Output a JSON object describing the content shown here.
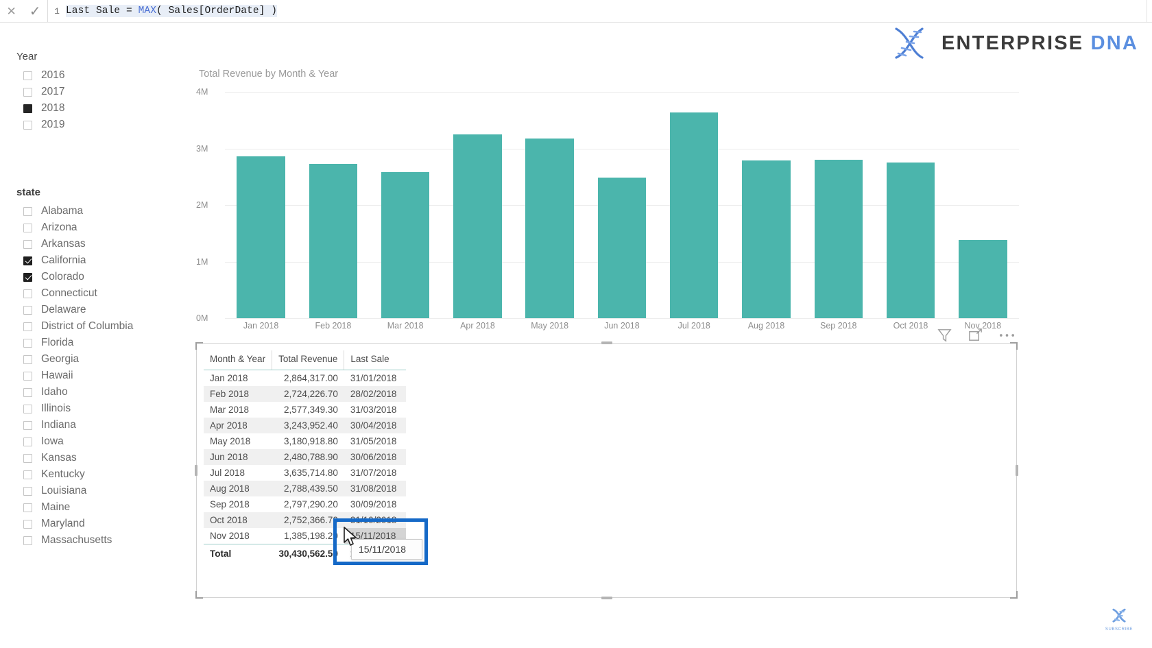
{
  "formula_bar": {
    "line_number": "1",
    "text_prefix": "Last Sale = ",
    "function": "MAX",
    "text_suffix": "( Sales[OrderDate] )",
    "full_text": "Last Sale = MAX( Sales[OrderDate] )",
    "cancel_icon": "close-icon",
    "commit_icon": "checkmark-icon"
  },
  "brand": {
    "logo_icon": "dna-helix-icon",
    "name_primary": "ENTERPRISE",
    "name_secondary": "DNA"
  },
  "slicers": {
    "year": {
      "title": "Year",
      "items": [
        {
          "label": "2016",
          "state": "unchecked"
        },
        {
          "label": "2017",
          "state": "unchecked"
        },
        {
          "label": "2018",
          "state": "filled"
        },
        {
          "label": "2019",
          "state": "unchecked"
        }
      ]
    },
    "state": {
      "title": "state",
      "items": [
        {
          "label": "Alabama",
          "state": "unchecked"
        },
        {
          "label": "Arizona",
          "state": "unchecked"
        },
        {
          "label": "Arkansas",
          "state": "unchecked"
        },
        {
          "label": "California",
          "state": "checked"
        },
        {
          "label": "Colorado",
          "state": "checked"
        },
        {
          "label": "Connecticut",
          "state": "unchecked"
        },
        {
          "label": "Delaware",
          "state": "unchecked"
        },
        {
          "label": "District of Columbia",
          "state": "unchecked"
        },
        {
          "label": "Florida",
          "state": "unchecked"
        },
        {
          "label": "Georgia",
          "state": "unchecked"
        },
        {
          "label": "Hawaii",
          "state": "unchecked"
        },
        {
          "label": "Idaho",
          "state": "unchecked"
        },
        {
          "label": "Illinois",
          "state": "unchecked"
        },
        {
          "label": "Indiana",
          "state": "unchecked"
        },
        {
          "label": "Iowa",
          "state": "unchecked"
        },
        {
          "label": "Kansas",
          "state": "unchecked"
        },
        {
          "label": "Kentucky",
          "state": "unchecked"
        },
        {
          "label": "Louisiana",
          "state": "unchecked"
        },
        {
          "label": "Maine",
          "state": "unchecked"
        },
        {
          "label": "Maryland",
          "state": "unchecked"
        },
        {
          "label": "Massachusetts",
          "state": "unchecked"
        }
      ]
    }
  },
  "chart_data": {
    "type": "bar",
    "title": "Total Revenue by Month & Year",
    "xlabel": "",
    "ylabel": "",
    "categories": [
      "Jan 2018",
      "Feb 2018",
      "Mar 2018",
      "Apr 2018",
      "May 2018",
      "Jun 2018",
      "Jul 2018",
      "Aug 2018",
      "Sep 2018",
      "Oct 2018",
      "Nov 2018"
    ],
    "values": [
      2864317.0,
      2724226.7,
      2577349.3,
      3243952.4,
      3180918.8,
      2480788.9,
      3635714.8,
      2788439.5,
      2797290.2,
      2752366.7,
      1385198.2
    ],
    "ylim": [
      0,
      4000000
    ],
    "y_ticks": [
      "0M",
      "1M",
      "2M",
      "3M",
      "4M"
    ],
    "y_tick_values": [
      0,
      1000000,
      2000000,
      3000000,
      4000000
    ],
    "bar_color": "#4bb5ac",
    "grid": true,
    "legend": "none"
  },
  "chart_visual_icons": [
    {
      "name": "filter-icon",
      "label": "Filters"
    },
    {
      "name": "focus-mode-icon",
      "label": "Focus mode"
    },
    {
      "name": "more-options-icon",
      "label": "More options"
    }
  ],
  "table": {
    "columns": [
      "Month & Year",
      "Total Revenue",
      "Last Sale"
    ],
    "rows": [
      {
        "month": "Jan 2018",
        "revenue": "2,864,317.00",
        "last_sale": "31/01/2018"
      },
      {
        "month": "Feb 2018",
        "revenue": "2,724,226.70",
        "last_sale": "28/02/2018"
      },
      {
        "month": "Mar 2018",
        "revenue": "2,577,349.30",
        "last_sale": "31/03/2018"
      },
      {
        "month": "Apr 2018",
        "revenue": "3,243,952.40",
        "last_sale": "30/04/2018"
      },
      {
        "month": "May 2018",
        "revenue": "3,180,918.80",
        "last_sale": "31/05/2018"
      },
      {
        "month": "Jun 2018",
        "revenue": "2,480,788.90",
        "last_sale": "30/06/2018"
      },
      {
        "month": "Jul 2018",
        "revenue": "3,635,714.80",
        "last_sale": "31/07/2018"
      },
      {
        "month": "Aug 2018",
        "revenue": "2,788,439.50",
        "last_sale": "31/08/2018"
      },
      {
        "month": "Sep 2018",
        "revenue": "2,797,290.20",
        "last_sale": "30/09/2018"
      },
      {
        "month": "Oct 2018",
        "revenue": "2,752,366.70",
        "last_sale": "31/10/2018"
      },
      {
        "month": "Nov 2018",
        "revenue": "1,385,198.20",
        "last_sale": "15/11/2018"
      }
    ],
    "total_row": {
      "month": "Total",
      "revenue": "30,430,562.50",
      "last_sale": "15/11/2018"
    }
  },
  "tooltip": {
    "value": "15/11/2018"
  },
  "highlight": {
    "color": "#1569c7"
  },
  "watermark": {
    "icon": "dna-helix-icon",
    "label": "SUBSCRIBE"
  }
}
